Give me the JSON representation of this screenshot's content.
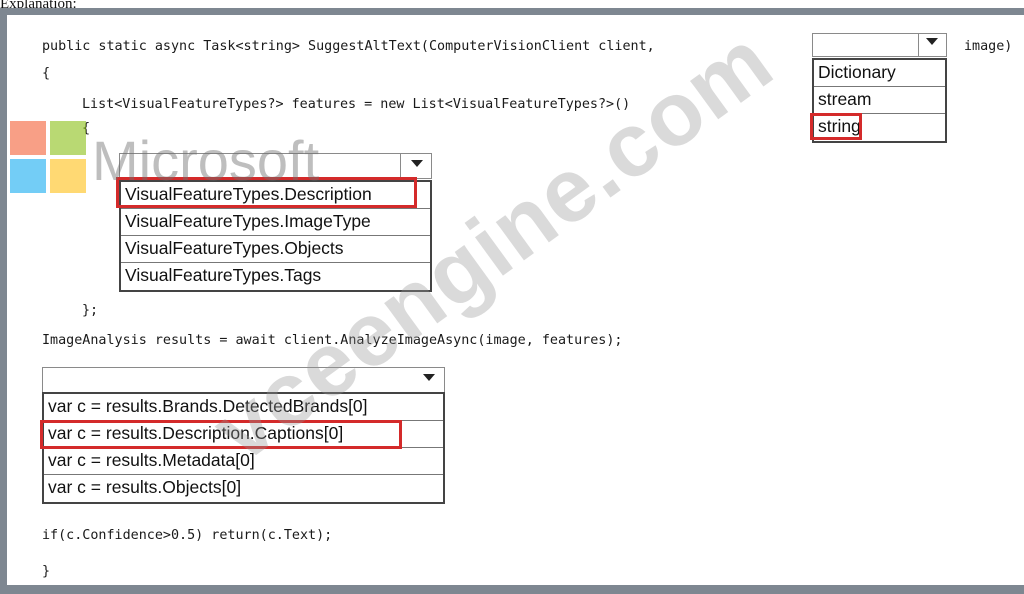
{
  "header": {
    "label": "Explanation:"
  },
  "code": {
    "line1": "public static async Task<string> SuggestAltText(ComputerVisionClient client,",
    "line1_tail": "image)",
    "line2": "{",
    "line3": "List<VisualFeatureTypes?> features = new List<VisualFeatureTypes?>()",
    "line4": "{",
    "line5": "};",
    "line6": "ImageAnalysis results = await client.AnalyzeImageAsync(image, features);",
    "line7": "if(c.Confidence>0.5) return(c.Text);",
    "line8": "}"
  },
  "dropdown_type": {
    "options": [
      "Dictionary",
      "stream",
      "string"
    ],
    "selected_index": 2
  },
  "dropdown_features": {
    "options": [
      "VisualFeatureTypes.Description",
      "VisualFeatureTypes.ImageType",
      "VisualFeatureTypes.Objects",
      "VisualFeatureTypes.Tags"
    ],
    "selected_index": 0
  },
  "dropdown_result": {
    "options": [
      "var c = results.Brands.DetectedBrands[0]",
      "var c = results.Description.Captions[0]",
      "var c = results.Metadata[0]",
      "var c = results.Objects[0]"
    ],
    "selected_index": 1
  },
  "watermarks": {
    "brand": "Microsoft",
    "site": "vceengine.com"
  },
  "colors": {
    "frame": "#7e8791",
    "highlight": "#d42a2a",
    "ms_red": "#f25022",
    "ms_green": "#7fba00",
    "ms_blue": "#00a4ef",
    "ms_yellow": "#ffb900"
  }
}
